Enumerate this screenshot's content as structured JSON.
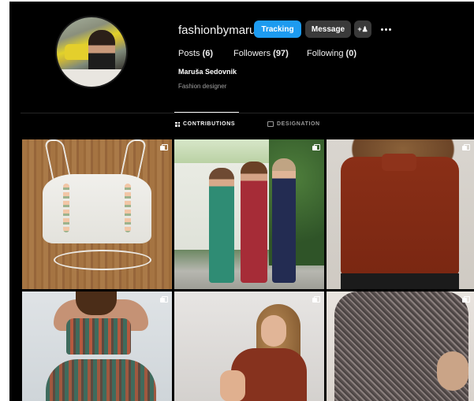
{
  "profile": {
    "username": "fashionbymaru",
    "buttons": {
      "follow": "Tracking",
      "message": "Message",
      "suggest_icon": "+R"
    },
    "more_icon": "more-dots-icon",
    "stats": [
      {
        "label": "Posts",
        "value": "6"
      },
      {
        "label": "Followers",
        "value": "97"
      },
      {
        "label": "Following",
        "value": "0"
      }
    ],
    "full_name": "Maruša Sedovnik",
    "bio": "Fashion designer"
  },
  "tabs": [
    {
      "label": "CONTRIBUTIONS",
      "icon": "grid-icon",
      "active": true
    },
    {
      "label": "DESIGNATION",
      "icon": "tag-icon",
      "active": false
    }
  ],
  "posts": [
    {
      "subject": "white corset top on wood",
      "multi": true
    },
    {
      "subject": "three women in prom gowns",
      "multi": true
    },
    {
      "subject": "rust sleeveless top",
      "multi": true
    },
    {
      "subject": "striped bandeau two-piece",
      "multi": true
    },
    {
      "subject": "woman in rust tee",
      "multi": true
    },
    {
      "subject": "patterned tiered dress",
      "multi": true
    }
  ],
  "colors": {
    "background": "#000000",
    "primary_button": "#1d9bf0",
    "secondary_button": "#3a3a3a"
  }
}
